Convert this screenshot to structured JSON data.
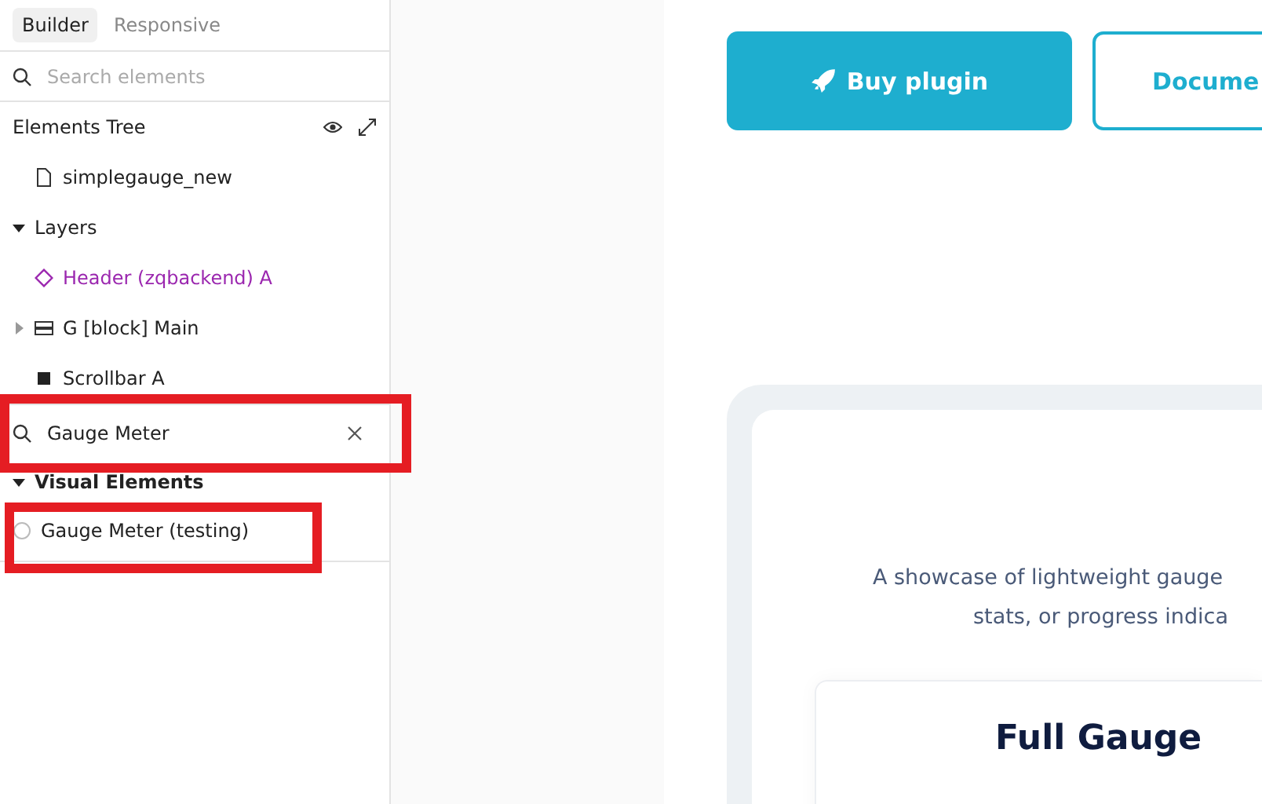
{
  "sidebar": {
    "tabs": [
      {
        "label": "Builder",
        "selected": true
      },
      {
        "label": "Responsive",
        "selected": false
      }
    ],
    "search": {
      "placeholder": "Search elements"
    },
    "tree_title": "Elements Tree",
    "tree": [
      {
        "kind": "file",
        "label": "simplegauge_new"
      },
      {
        "kind": "section",
        "label": "Layers",
        "expanded": true,
        "children": [
          {
            "kind": "component",
            "label": "Header (zqbackend) A"
          },
          {
            "kind": "block",
            "label": "G [block] Main",
            "expanded": false
          },
          {
            "kind": "element",
            "label": "Scrollbar A"
          }
        ]
      }
    ],
    "filter": {
      "value": "Gauge Meter"
    },
    "results": {
      "label": "Visual Elements",
      "expanded": true,
      "children": [
        {
          "kind": "gauge",
          "label": "Gauge Meter (testing)"
        }
      ]
    }
  },
  "canvas": {
    "buttons": [
      {
        "kind": "primary",
        "label": "Buy plugin"
      },
      {
        "kind": "outline",
        "label": "Docume"
      }
    ],
    "intro_lines": [
      "A showcase of lightweight gauge",
      "stats, or progress indica"
    ],
    "card_title": "Full Gauge"
  }
}
